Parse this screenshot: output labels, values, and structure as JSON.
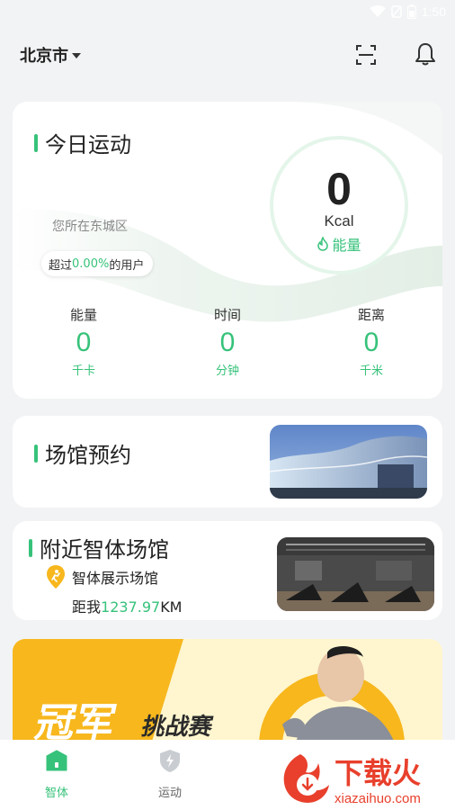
{
  "status_bar": {
    "time": "1:50"
  },
  "header": {
    "city": "北京市"
  },
  "today": {
    "title": "今日运动",
    "location": "您所在东城区",
    "rank_prefix": "超过",
    "rank_value": "0.00%",
    "rank_suffix": "的用户",
    "ring_value": "0",
    "ring_unit": "Kcal",
    "ring_label": "能量",
    "stats": [
      {
        "label": "能量",
        "value": "0",
        "unit": "千卡"
      },
      {
        "label": "时间",
        "value": "0",
        "unit": "分钟"
      },
      {
        "label": "距离",
        "value": "0",
        "unit": "千米"
      }
    ]
  },
  "venue_booking": {
    "title": "场馆预约"
  },
  "nearby": {
    "title": "附近智体场馆",
    "place": "智体展示场馆",
    "distance_prefix": "距我",
    "distance_value": "1237.97",
    "distance_unit": "KM"
  },
  "banner": {
    "main_text": "冠军",
    "sub_text": "挑战赛"
  },
  "tabs": [
    {
      "label": "智体",
      "active": true
    },
    {
      "label": "运动",
      "active": false
    }
  ],
  "watermark": {
    "text": "下载火",
    "url": "xiazaihuo.com"
  },
  "colors": {
    "accent": "#36c27a",
    "banner_yellow": "#f7b71d",
    "watermark_red": "#e8402c"
  }
}
